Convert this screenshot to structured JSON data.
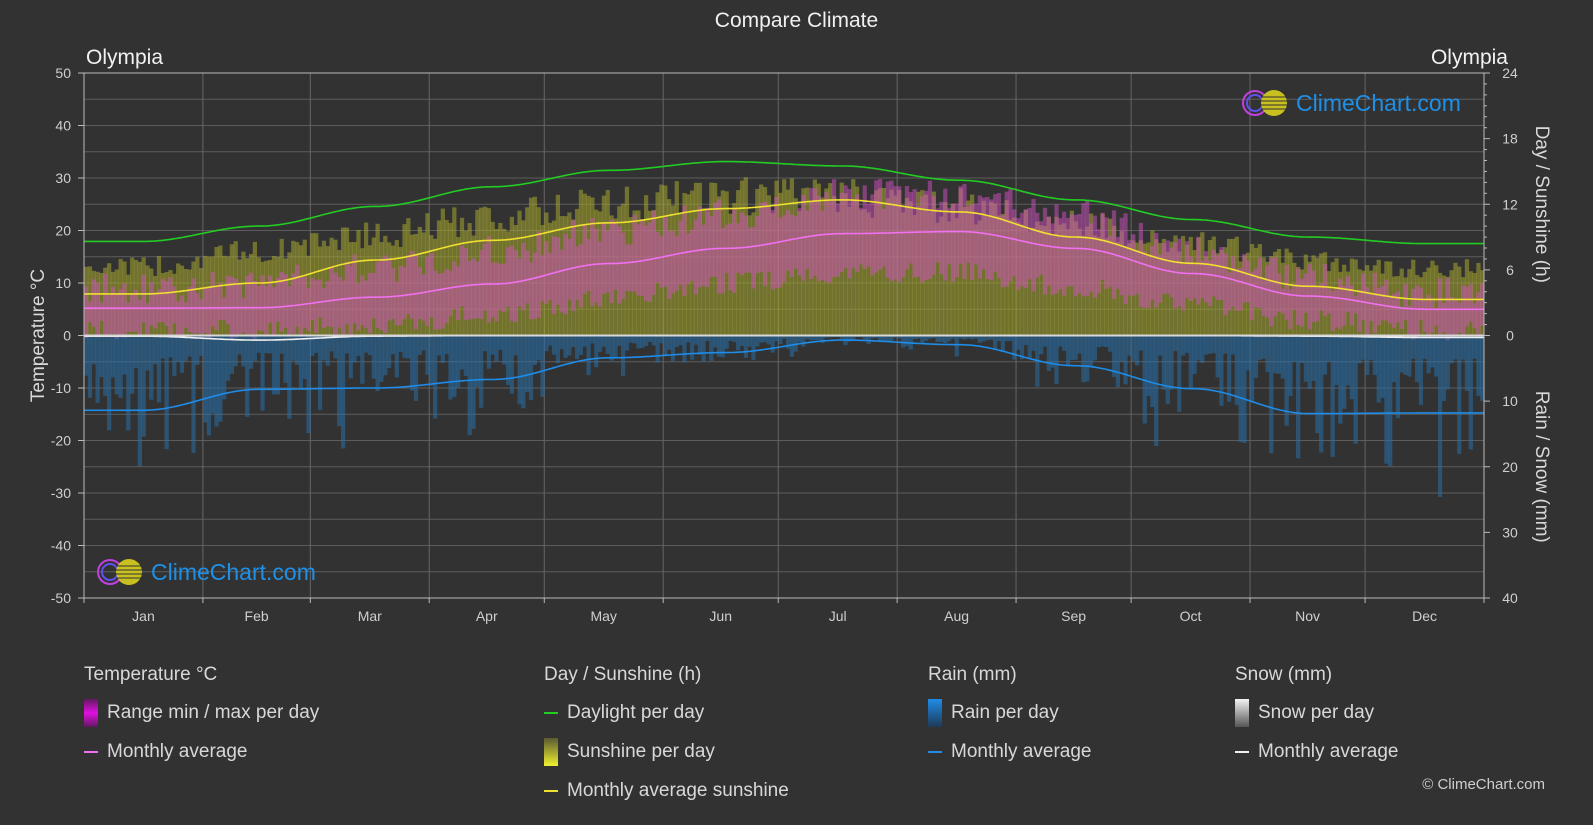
{
  "title": "Compare Climate",
  "location_left": "Olympia",
  "location_right": "Olympia",
  "logo_text": "ClimeChart.com",
  "copyright": "© ClimeChart.com",
  "colors": {
    "background": "#323232",
    "grid": "#5a5a5a",
    "temp_range": "#e020e0",
    "temp_avg": "#f070f0",
    "daylight": "#22cc22",
    "sunshine": "#c8c832",
    "sunshine_avg": "#f0e030",
    "rain": "#1e6fb0",
    "rain_avg": "#1e8ce8",
    "snow": "#a0a0a0",
    "snow_avg": "#f0f0f0"
  },
  "legend": {
    "temperature": {
      "heading": "Temperature °C",
      "range_label": "Range min / max per day",
      "avg_label": "Monthly average"
    },
    "sunshine": {
      "heading": "Day / Sunshine (h)",
      "daylight_label": "Daylight per day",
      "sunshine_label": "Sunshine per day",
      "avg_label": "Monthly average sunshine"
    },
    "rain": {
      "heading": "Rain (mm)",
      "per_day_label": "Rain per day",
      "avg_label": "Monthly average"
    },
    "snow": {
      "heading": "Snow (mm)",
      "per_day_label": "Snow per day",
      "avg_label": "Monthly average"
    }
  },
  "chart_data": {
    "type": "line",
    "title": "Compare Climate",
    "categories": [
      "Jan",
      "Feb",
      "Mar",
      "Apr",
      "May",
      "Jun",
      "Jul",
      "Aug",
      "Sep",
      "Oct",
      "Nov",
      "Dec"
    ],
    "axes": {
      "left": {
        "label": "Temperature °C",
        "range": [
          -50,
          50
        ],
        "ticks": [
          50,
          40,
          30,
          20,
          10,
          0,
          -10,
          -20,
          -30,
          -40,
          -50
        ]
      },
      "right_top": {
        "label": "Day / Sunshine (h)",
        "range": [
          0,
          24
        ],
        "ticks": [
          24,
          18,
          12,
          6,
          0
        ]
      },
      "right_bottom": {
        "label": "Rain / Snow (mm)",
        "range": [
          0,
          40
        ],
        "ticks": [
          0,
          10,
          20,
          30,
          40
        ]
      }
    },
    "grid": true,
    "series": [
      {
        "name": "Temperature monthly average",
        "axis": "left",
        "unit": "°C",
        "values": [
          5.2,
          5.3,
          7.3,
          9.8,
          13.7,
          16.6,
          19.4,
          19.8,
          16.6,
          11.8,
          7.5,
          5.0
        ]
      },
      {
        "name": "Temperature daily max (approx)",
        "axis": "left",
        "unit": "°C",
        "values": [
          9,
          10,
          13,
          16,
          20,
          23,
          27,
          27,
          23,
          16,
          11,
          8
        ]
      },
      {
        "name": "Temperature daily min (approx)",
        "axis": "left",
        "unit": "°C",
        "values": [
          1,
          1,
          2,
          4,
          7,
          10,
          12,
          12,
          9,
          6,
          3,
          1
        ]
      },
      {
        "name": "Daylight per day",
        "axis": "right_top",
        "unit": "h",
        "values": [
          8.6,
          10.0,
          11.8,
          13.6,
          15.1,
          15.9,
          15.5,
          14.2,
          12.4,
          10.6,
          9.0,
          8.4
        ]
      },
      {
        "name": "Sunshine per day (max envelope)",
        "axis": "right_top",
        "unit": "h",
        "values": [
          7.2,
          8.8,
          10.5,
          12.3,
          13.8,
          14.5,
          14.5,
          13.5,
          11.6,
          9.6,
          7.8,
          7.0
        ]
      },
      {
        "name": "Monthly average sunshine",
        "axis": "right_top",
        "unit": "h",
        "values": [
          3.8,
          4.8,
          6.9,
          8.7,
          10.3,
          11.6,
          12.4,
          11.3,
          9.0,
          6.6,
          4.5,
          3.3
        ]
      },
      {
        "name": "Rain monthly average",
        "axis": "right_bottom",
        "unit": "mm",
        "values": [
          11.4,
          8.2,
          8.0,
          6.7,
          3.4,
          2.6,
          0.7,
          1.4,
          4.6,
          8.1,
          11.9,
          11.8
        ]
      },
      {
        "name": "Snow monthly average",
        "axis": "right_bottom",
        "unit": "mm",
        "values": [
          0.1,
          0.7,
          0.1,
          0,
          0,
          0,
          0,
          0,
          0,
          0,
          0.1,
          0.3
        ]
      }
    ]
  }
}
